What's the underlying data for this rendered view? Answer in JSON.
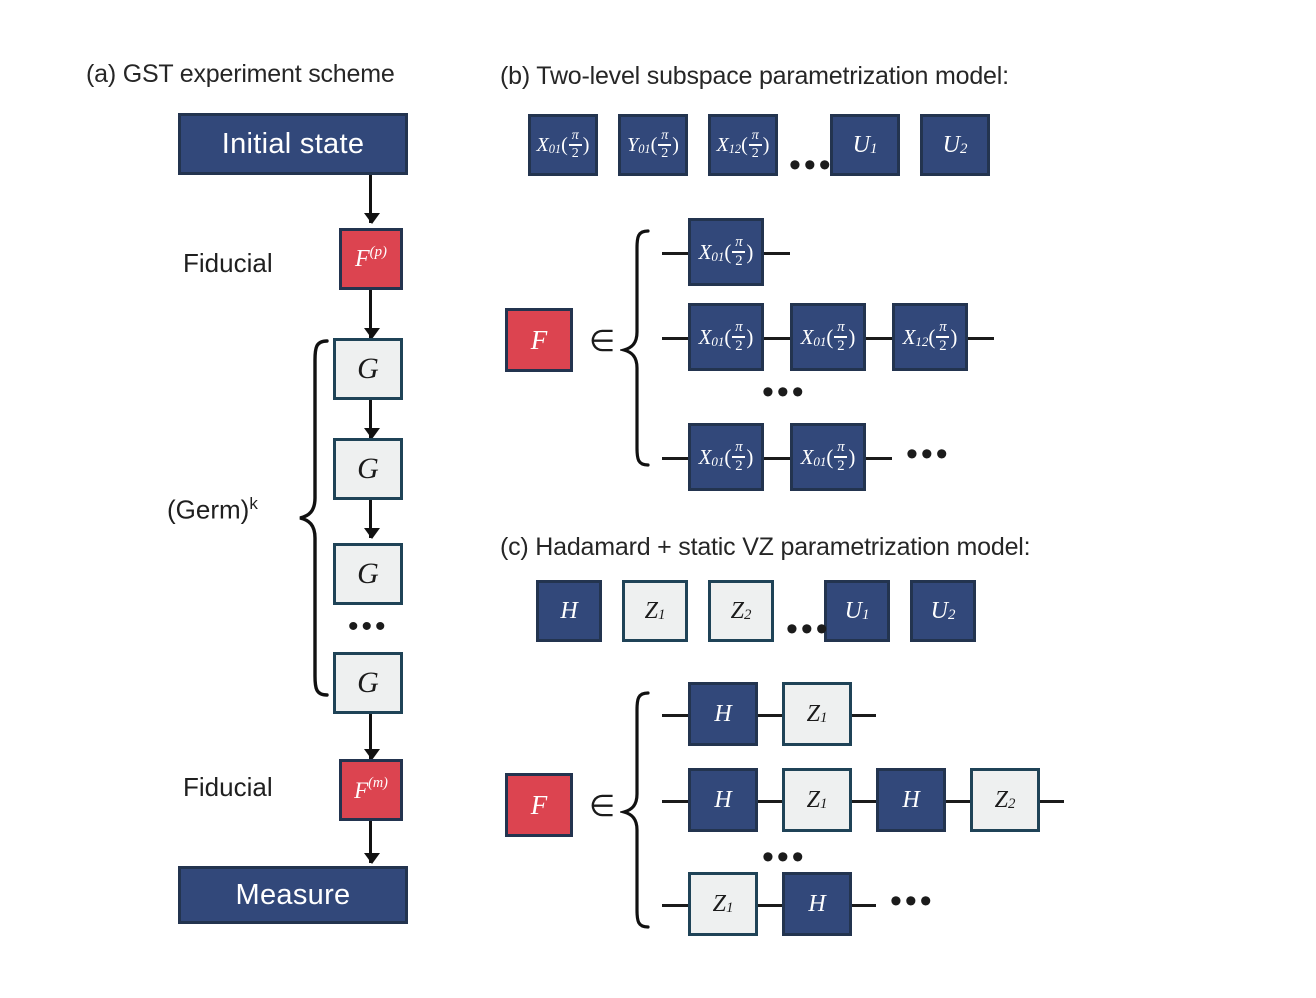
{
  "figure": {
    "background": "#ffffff",
    "colors": {
      "blue": "#32487a",
      "red": "#dc4450",
      "grey": "#eef0f0",
      "border_dark": "#23344f",
      "border_grey_box": "#1f4357",
      "text_dark": "#1b1b1b"
    }
  },
  "panel_a": {
    "label": "(a)",
    "title": "(a)  GST experiment scheme",
    "initial_state_label": "Initial state",
    "measure_label": "Measure",
    "fiducial_prep_label": "Fiducial",
    "fiducial_meas_label": "Fiducial",
    "germ_label_base": "(Germ)",
    "germ_label_exponent": "k",
    "germ_gate_label": "G",
    "germ_gates": [
      "G",
      "G",
      "G",
      "G"
    ],
    "germ_ellipsis": "•••",
    "fiducial_prep_symbol": "F",
    "fiducial_prep_superscript": "(p)",
    "fiducial_meas_symbol": "F",
    "fiducial_meas_superscript": "(m)"
  },
  "panel_b": {
    "label": "(b)",
    "title": "(b) Two-level subspace parametrization model:",
    "gate_set": [
      {
        "base": "X",
        "sub": "01",
        "arg_num": "π",
        "arg_den": "2",
        "style": "blue"
      },
      {
        "base": "Y",
        "sub": "01",
        "arg_num": "π",
        "arg_den": "2",
        "style": "blue"
      },
      {
        "base": "X",
        "sub": "12",
        "arg_num": "π",
        "arg_den": "2",
        "style": "blue"
      },
      {
        "base": "U",
        "sub": "1",
        "style": "blue"
      },
      {
        "base": "U",
        "sub": "2",
        "style": "blue"
      }
    ],
    "gate_set_ellipsis": "•••",
    "fiducial_symbol": "F",
    "membership_symbol": "∈",
    "fiducial_rows": [
      {
        "gates": [
          {
            "base": "X",
            "sub": "01",
            "arg_num": "π",
            "arg_den": "2",
            "style": "blue"
          }
        ],
        "trailing_ellipsis": ""
      },
      {
        "gates": [
          {
            "base": "X",
            "sub": "01",
            "arg_num": "π",
            "arg_den": "2",
            "style": "blue"
          },
          {
            "base": "X",
            "sub": "01",
            "arg_num": "π",
            "arg_den": "2",
            "style": "blue"
          },
          {
            "base": "X",
            "sub": "12",
            "arg_num": "π",
            "arg_den": "2",
            "style": "blue"
          }
        ],
        "trailing_ellipsis": ""
      },
      {
        "gates": [
          {
            "base": "X",
            "sub": "01",
            "arg_num": "π",
            "arg_den": "2",
            "style": "blue"
          },
          {
            "base": "X",
            "sub": "01",
            "arg_num": "π",
            "arg_den": "2",
            "style": "blue"
          }
        ],
        "trailing_ellipsis": "•••"
      }
    ],
    "row_separator_ellipsis": "•••"
  },
  "panel_c": {
    "label": "(c)",
    "title": "(c) Hadamard + static VZ parametrization model:",
    "gate_set": [
      {
        "base": "H",
        "sub": "",
        "style": "blue"
      },
      {
        "base": "Z",
        "sub": "1",
        "style": "grey"
      },
      {
        "base": "Z",
        "sub": "2",
        "style": "grey"
      },
      {
        "base": "U",
        "sub": "1",
        "style": "blue"
      },
      {
        "base": "U",
        "sub": "2",
        "style": "blue"
      }
    ],
    "gate_set_ellipsis": "•••",
    "fiducial_symbol": "F",
    "membership_symbol": "∈",
    "fiducial_rows": [
      {
        "gates": [
          {
            "base": "H",
            "sub": "",
            "style": "blue"
          },
          {
            "base": "Z",
            "sub": "1",
            "style": "grey"
          }
        ],
        "trailing_ellipsis": ""
      },
      {
        "gates": [
          {
            "base": "H",
            "sub": "",
            "style": "blue"
          },
          {
            "base": "Z",
            "sub": "1",
            "style": "grey"
          },
          {
            "base": "H",
            "sub": "",
            "style": "blue"
          },
          {
            "base": "Z",
            "sub": "2",
            "style": "grey"
          }
        ],
        "trailing_ellipsis": ""
      },
      {
        "gates": [
          {
            "base": "Z",
            "sub": "1",
            "style": "grey"
          },
          {
            "base": "H",
            "sub": "",
            "style": "blue"
          }
        ],
        "trailing_ellipsis": "•••"
      }
    ],
    "row_separator_ellipsis": "•••"
  }
}
